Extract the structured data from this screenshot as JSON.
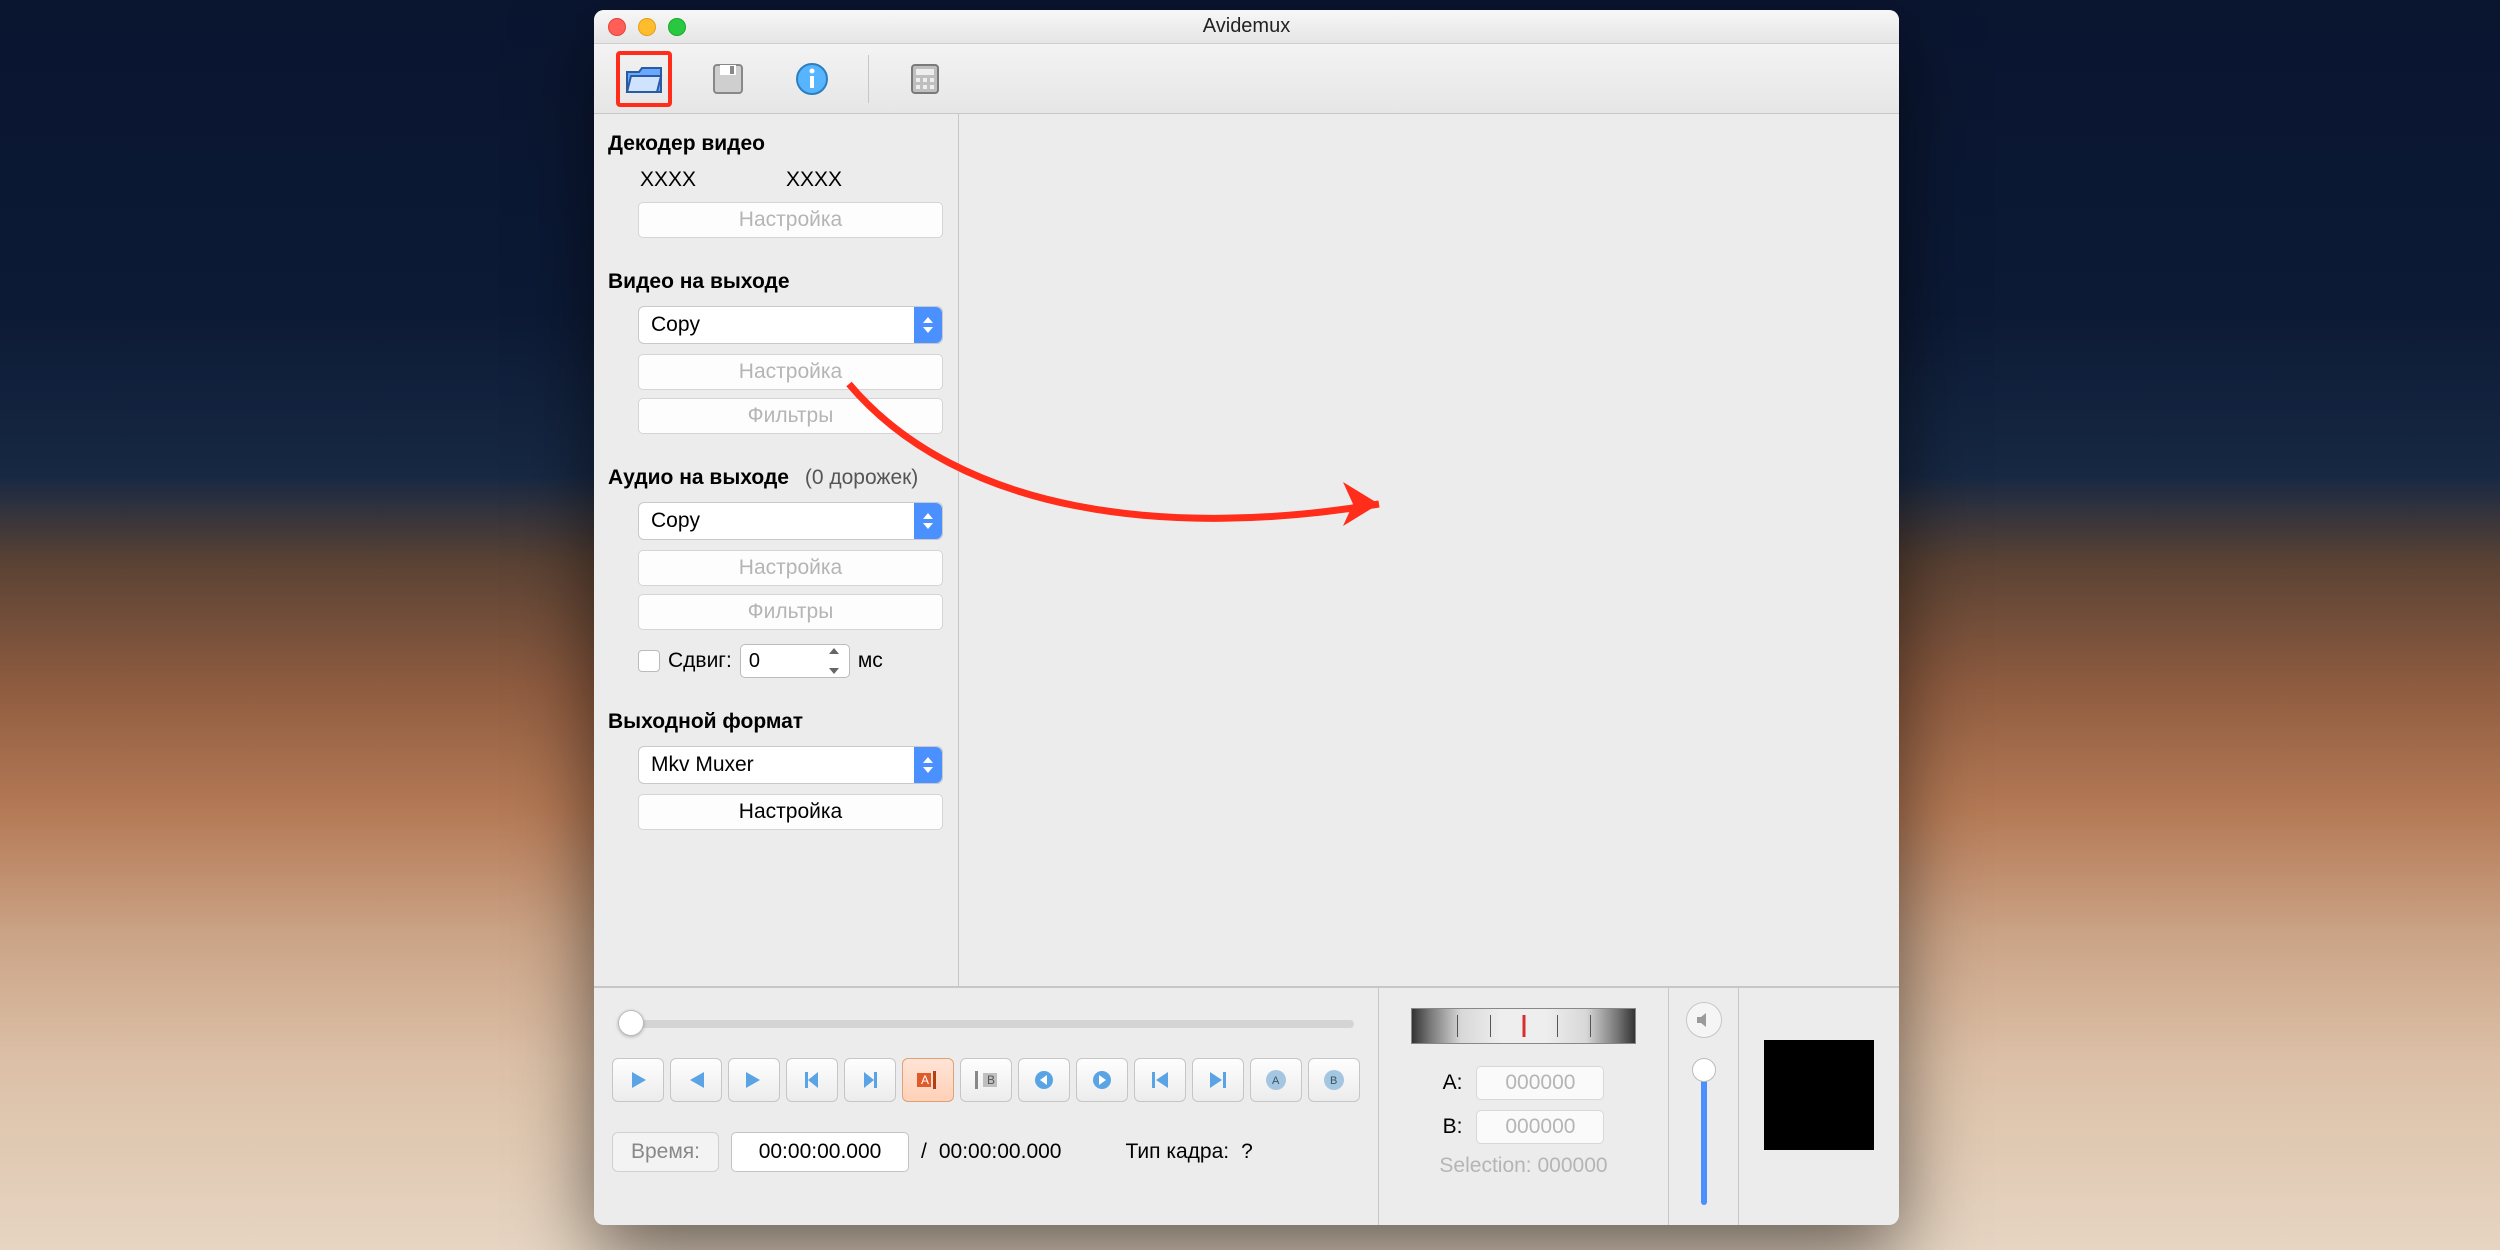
{
  "window_title": "Avidemux",
  "annotation": {
    "highlight_toolbar_index": 0
  },
  "sidebar": {
    "decoder": {
      "title": "Декодер видео",
      "xxxx1": "XXXX",
      "xxxx2": "XXXX",
      "config": "Настройка"
    },
    "video_out": {
      "title": "Видео на выходе",
      "codec": "Copy",
      "config": "Настройка",
      "filters": "Фильтры"
    },
    "audio_out": {
      "title": "Аудио на выходе",
      "tracks": "(0 дорожек)",
      "codec": "Copy",
      "config": "Настройка",
      "filters": "Фильтры",
      "shift_label": "Сдвиг:",
      "shift_value": "0",
      "shift_unit": "мс"
    },
    "output_fmt": {
      "title": "Выходной формат",
      "muxer": "Mkv Muxer",
      "config": "Настройка"
    }
  },
  "timeline": {
    "time_button": "Время:",
    "time_value": "00:00:00.000",
    "duration_sep": "/",
    "duration": "00:00:00.000",
    "frame_type_label": "Тип кадра:",
    "frame_type_value": "?"
  },
  "selection": {
    "a_label": "A:",
    "a_value": "000000",
    "b_label": "B:",
    "b_value": "000000",
    "sel_label": "Selection:",
    "sel_value": "000000"
  }
}
